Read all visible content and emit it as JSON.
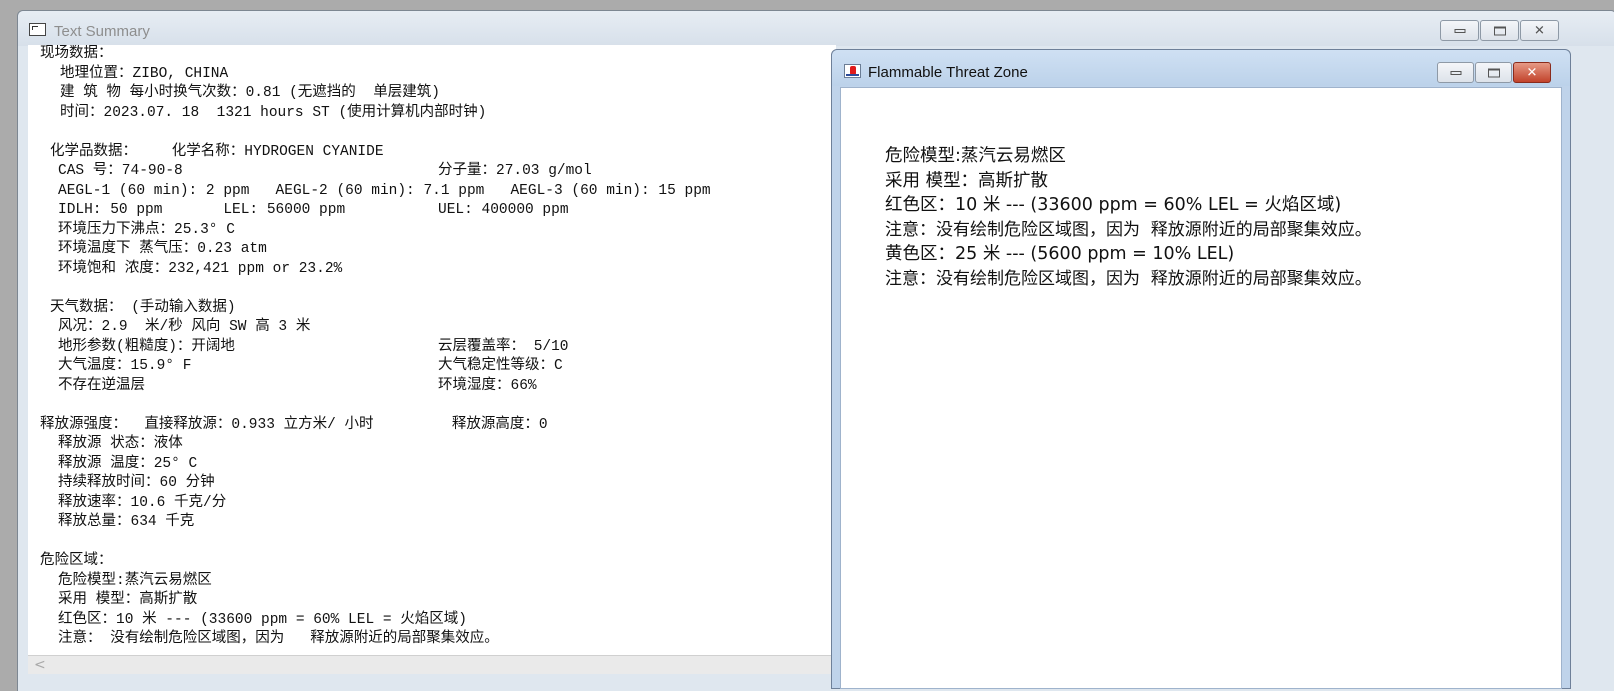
{
  "main_window": {
    "title": "Text Summary",
    "summary_lines": [
      {
        "text": "现场数据：",
        "x": 0
      },
      {
        "text": "地理位置：ZIBO, CHINA",
        "x": 20
      },
      {
        "text": "建 筑 物 每小时换气次数：0.81 (无遮挡的  单层建筑)",
        "x": 20
      },
      {
        "text": "时间：2023.07. 18  1321 hours ST (使用计算机内部时钟)",
        "x": 20
      },
      {
        "text": "",
        "x": 0
      },
      {
        "text": "化学品数据：    化学名称：HYDROGEN CYANIDE",
        "x": 10
      },
      {
        "text": "CAS 号：74-90-8",
        "x": 18,
        "col2": "分子量：27.03 g/mol"
      },
      {
        "text": "AEGL-1 (60 min): 2 ppm   AEGL-2 (60 min): 7.1 ppm   AEGL-3 (60 min): 15 ppm",
        "x": 18
      },
      {
        "text": "IDLH: 50 ppm       LEL: 56000 ppm",
        "x": 18,
        "col2": "UEL: 400000 ppm"
      },
      {
        "text": "环境压力下沸点：25.3° C",
        "x": 18
      },
      {
        "text": "环境温度下 蒸气压：0.23 atm",
        "x": 18
      },
      {
        "text": "环境饱和 浓度：232,421 ppm or 23.2%",
        "x": 18
      },
      {
        "text": "",
        "x": 0
      },
      {
        "text": "天气数据： (手动输入数据)",
        "x": 10
      },
      {
        "text": "风况：2.9  米/秒 风向 SW 高 3 米",
        "x": 18
      },
      {
        "text": "地形参数(粗糙度)：开阔地",
        "x": 18,
        "col2": "云层覆盖率： 5/10"
      },
      {
        "text": "大气温度：15.9° F",
        "x": 18,
        "col2": "大气稳定性等级：C"
      },
      {
        "text": "不存在逆温层",
        "x": 18,
        "col2": "环境湿度：66%"
      },
      {
        "text": "",
        "x": 0
      },
      {
        "text": "释放源强度：  直接释放源：0.933 立方米/ 小时         释放源高度：0",
        "x": 0
      },
      {
        "text": "释放源 状态：液体",
        "x": 18
      },
      {
        "text": "释放源 温度：25° C",
        "x": 18
      },
      {
        "text": "持续释放时间：60 分钟",
        "x": 18
      },
      {
        "text": "释放速率：10.6 千克/分",
        "x": 18
      },
      {
        "text": "释放总量：634 千克",
        "x": 18
      },
      {
        "text": "",
        "x": 0
      },
      {
        "text": "危险区域：",
        "x": 0
      },
      {
        "text": "危险模型:蒸汽云易燃区",
        "x": 18
      },
      {
        "text": "采用 模型：高斯扩散",
        "x": 18
      },
      {
        "text": "红色区：10 米 --- (33600 ppm = 60% LEL = 火焰区域)",
        "x": 18
      },
      {
        "text": "注意： 没有绘制危险区域图，因为   释放源附近的局部聚集效应。",
        "x": 18
      }
    ],
    "scroll_left_arrow": "<"
  },
  "flam_window": {
    "title": "Flammable Threat Zone",
    "lines": [
      "危险模型:蒸汽云易燃区",
      "采用 模型：高斯扩散",
      "红色区：10 米 --- (33600 ppm = 60% LEL = 火焰区域)",
      "注意：没有绘制危险区域图，因为  释放源附近的局部聚集效应。",
      "黄色区：25 米 --- (5600 ppm = 10% LEL)",
      "注意：没有绘制危险区域图，因为  释放源附近的局部聚集效应。"
    ]
  },
  "window_buttons": {
    "minimize_glyph": "",
    "maximize_glyph": "",
    "close_glyph": "✕"
  }
}
